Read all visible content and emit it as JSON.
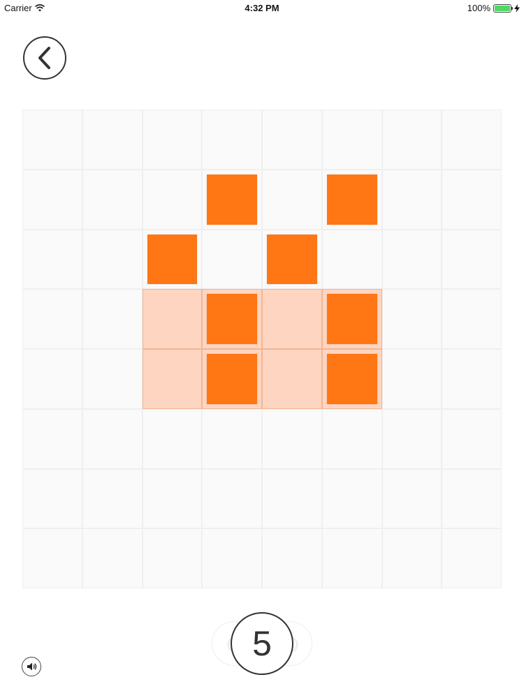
{
  "status_bar": {
    "carrier": "Carrier",
    "time": "4:32 PM",
    "battery_percent": "100%",
    "battery_level": 1.0,
    "icons": [
      "wifi-icon",
      "battery-icon",
      "charging-bolt-icon"
    ]
  },
  "back_button": {
    "icon": "chevron-left-icon"
  },
  "board": {
    "rows": 8,
    "cols": 8,
    "target_cells": [
      [
        3,
        2
      ],
      [
        3,
        3
      ],
      [
        3,
        4
      ],
      [
        3,
        5
      ],
      [
        4,
        2
      ],
      [
        4,
        3
      ],
      [
        4,
        4
      ],
      [
        4,
        5
      ]
    ],
    "blocks": [
      [
        1,
        3
      ],
      [
        1,
        5
      ],
      [
        2,
        2
      ],
      [
        2,
        4
      ],
      [
        3,
        3
      ],
      [
        3,
        5
      ],
      [
        4,
        3
      ],
      [
        4,
        5
      ]
    ]
  },
  "moves": {
    "value": "5"
  },
  "sound_button": {
    "icon": "speaker-icon"
  },
  "colors": {
    "block": "#ff7614",
    "target": "#fdd5c1",
    "cell": "#fafafa",
    "battery": "#4cd964"
  }
}
